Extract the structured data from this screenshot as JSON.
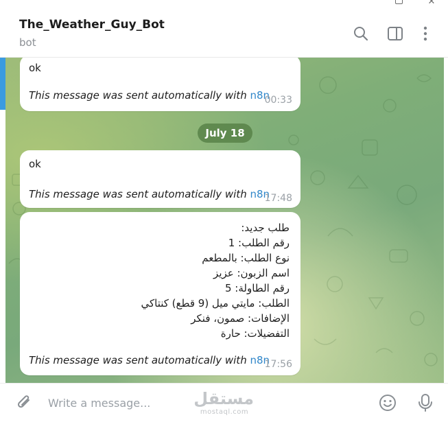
{
  "window": {
    "controls": [
      "minimize",
      "maximize",
      "close"
    ]
  },
  "header": {
    "title": "The_Weather_Guy_Bot",
    "subtitle": "bot",
    "icons": [
      "search-icon",
      "side-panel-icon",
      "more-vertical-icon"
    ]
  },
  "messages": [
    {
      "text": "ok",
      "auto_prefix": "This message was sent automatically with ",
      "auto_link": "n8n",
      "time": "00:33"
    },
    {
      "text": "ok",
      "auto_prefix": "This message was sent automatically with ",
      "auto_link": "n8n",
      "time": "17:48"
    },
    {
      "lines": [
        "طلب جديد:",
        "رقم الطلب: 1",
        "نوع الطلب: بالمطعم",
        "اسم الزبون: عزيز",
        "رقم الطاولة: 5",
        "الطلب: مايتي ميل (9 قطع) كنتاكي",
        "الإضافات: صمون، فنكر",
        "التفضيلات: حارة"
      ],
      "auto_prefix": "This message was sent automatically with ",
      "auto_link": "n8n",
      "time": "17:56"
    }
  ],
  "date_separator": "July 18",
  "composer": {
    "placeholder": "Write a message...",
    "icons": [
      "attach-icon",
      "emoji-icon",
      "microphone-icon"
    ]
  },
  "watermark": {
    "arabic": "مستقل",
    "latin": "mostaql.com"
  },
  "colors": {
    "link": "#2f86c9",
    "timestamp": "#9aa0a6",
    "date_pill": "#588248",
    "accent_bar": "#3a9be0"
  }
}
